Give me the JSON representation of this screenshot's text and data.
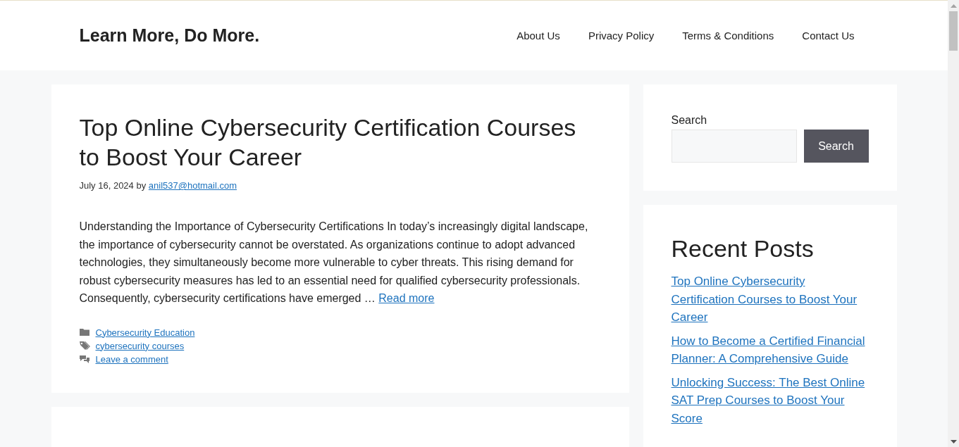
{
  "header": {
    "site_title": "Learn More, Do More.",
    "nav": [
      {
        "label": "About Us"
      },
      {
        "label": "Privacy Policy"
      },
      {
        "label": "Terms & Conditions"
      },
      {
        "label": "Contact Us"
      }
    ]
  },
  "article": {
    "title": "Top Online Cybersecurity Certification Courses to Boost Your Career",
    "date": "July 16, 2024",
    "by": "by",
    "author": "anil537@hotmail.com",
    "excerpt": "Understanding the Importance of Cybersecurity Certifications In today’s increasingly digital landscape, the importance of cybersecurity cannot be overstated. As organizations continue to adopt advanced technologies, they simultaneously become more vulnerable to cyber threats. This rising demand for robust cybersecurity measures has led to an essential need for qualified cybersecurity professionals. Consequently, cybersecurity certifications have emerged …",
    "read_more": "Read more",
    "meta": [
      {
        "kind": "category",
        "text": "Cybersecurity Education"
      },
      {
        "kind": "tag",
        "text": "cybersecurity courses"
      },
      {
        "kind": "comments",
        "text": "Leave a comment"
      }
    ]
  },
  "sidebar": {
    "search": {
      "label": "Search",
      "button": "Search"
    },
    "recent_posts": {
      "title": "Recent Posts",
      "items": [
        "Top Online Cybersecurity Certification Courses to Boost Your Career",
        "How to Become a Certified Financial Planner: A Comprehensive Guide",
        "Unlocking Success: The Best Online SAT Prep Courses to Boost Your Score"
      ]
    }
  }
}
